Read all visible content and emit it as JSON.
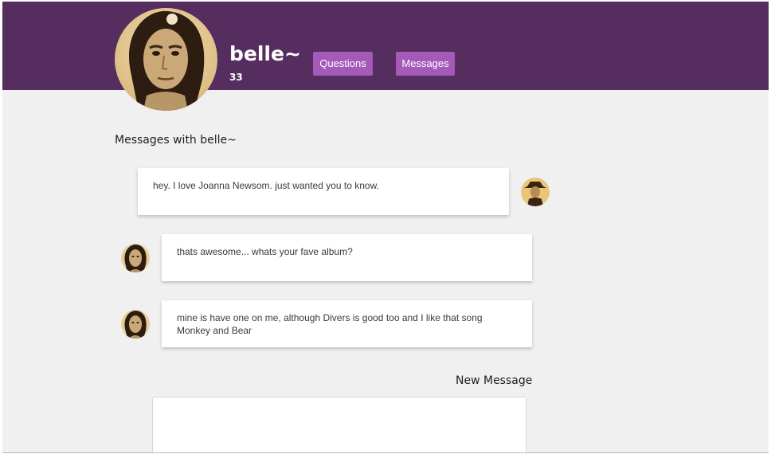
{
  "profile": {
    "username": "belle~",
    "age": "33",
    "avatar_icon": "portrait-woman-sepia"
  },
  "nav": {
    "questions_label": "Questions",
    "messages_label": "Messages",
    "button_color": "#a35ab8"
  },
  "colors": {
    "header_bg": "#552d5e",
    "page_bg": "#f1f0f1"
  },
  "conversation": {
    "title": "Messages with belle~",
    "messages": [
      {
        "from": "me",
        "avatar_icon": "portrait-cowboy-sepia",
        "text": "hey. I love Joanna Newsom. just wanted you to know."
      },
      {
        "from": "belle~",
        "avatar_icon": "portrait-woman-sepia",
        "text": "thats awesome... whats your fave album?"
      },
      {
        "from": "belle~",
        "avatar_icon": "portrait-woman-sepia",
        "text": "mine is have one on me, although Divers is good too and I like that song Monkey and Bear"
      }
    ]
  },
  "composer": {
    "label": "New Message",
    "placeholder": "",
    "value": ""
  }
}
